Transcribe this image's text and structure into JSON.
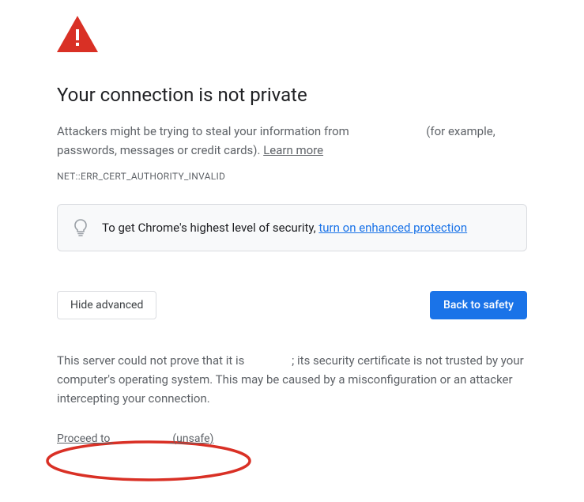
{
  "icon": "warning-triangle",
  "heading": "Your connection is not private",
  "description_prefix": "Attackers might be trying to steal your information from ",
  "description_suffix": " (for example, passwords, messages or credit cards). ",
  "learn_more": "Learn more",
  "error_code": "NET::ERR_CERT_AUTHORITY_INVALID",
  "tip_prefix": "To get Chrome's highest level of security, ",
  "tip_link": "turn on enhanced protection",
  "buttons": {
    "hide_advanced": "Hide advanced",
    "back_to_safety": "Back to safety"
  },
  "advanced_prefix": "This server could not prove that it is ",
  "advanced_suffix": "; its security certificate is not trusted by your computer's operating system. This may be caused by a misconfiguration or an attacker intercepting your connection.",
  "proceed_prefix": "Proceed to ",
  "proceed_suffix": " (unsafe)",
  "annotation_color": "#d93025"
}
